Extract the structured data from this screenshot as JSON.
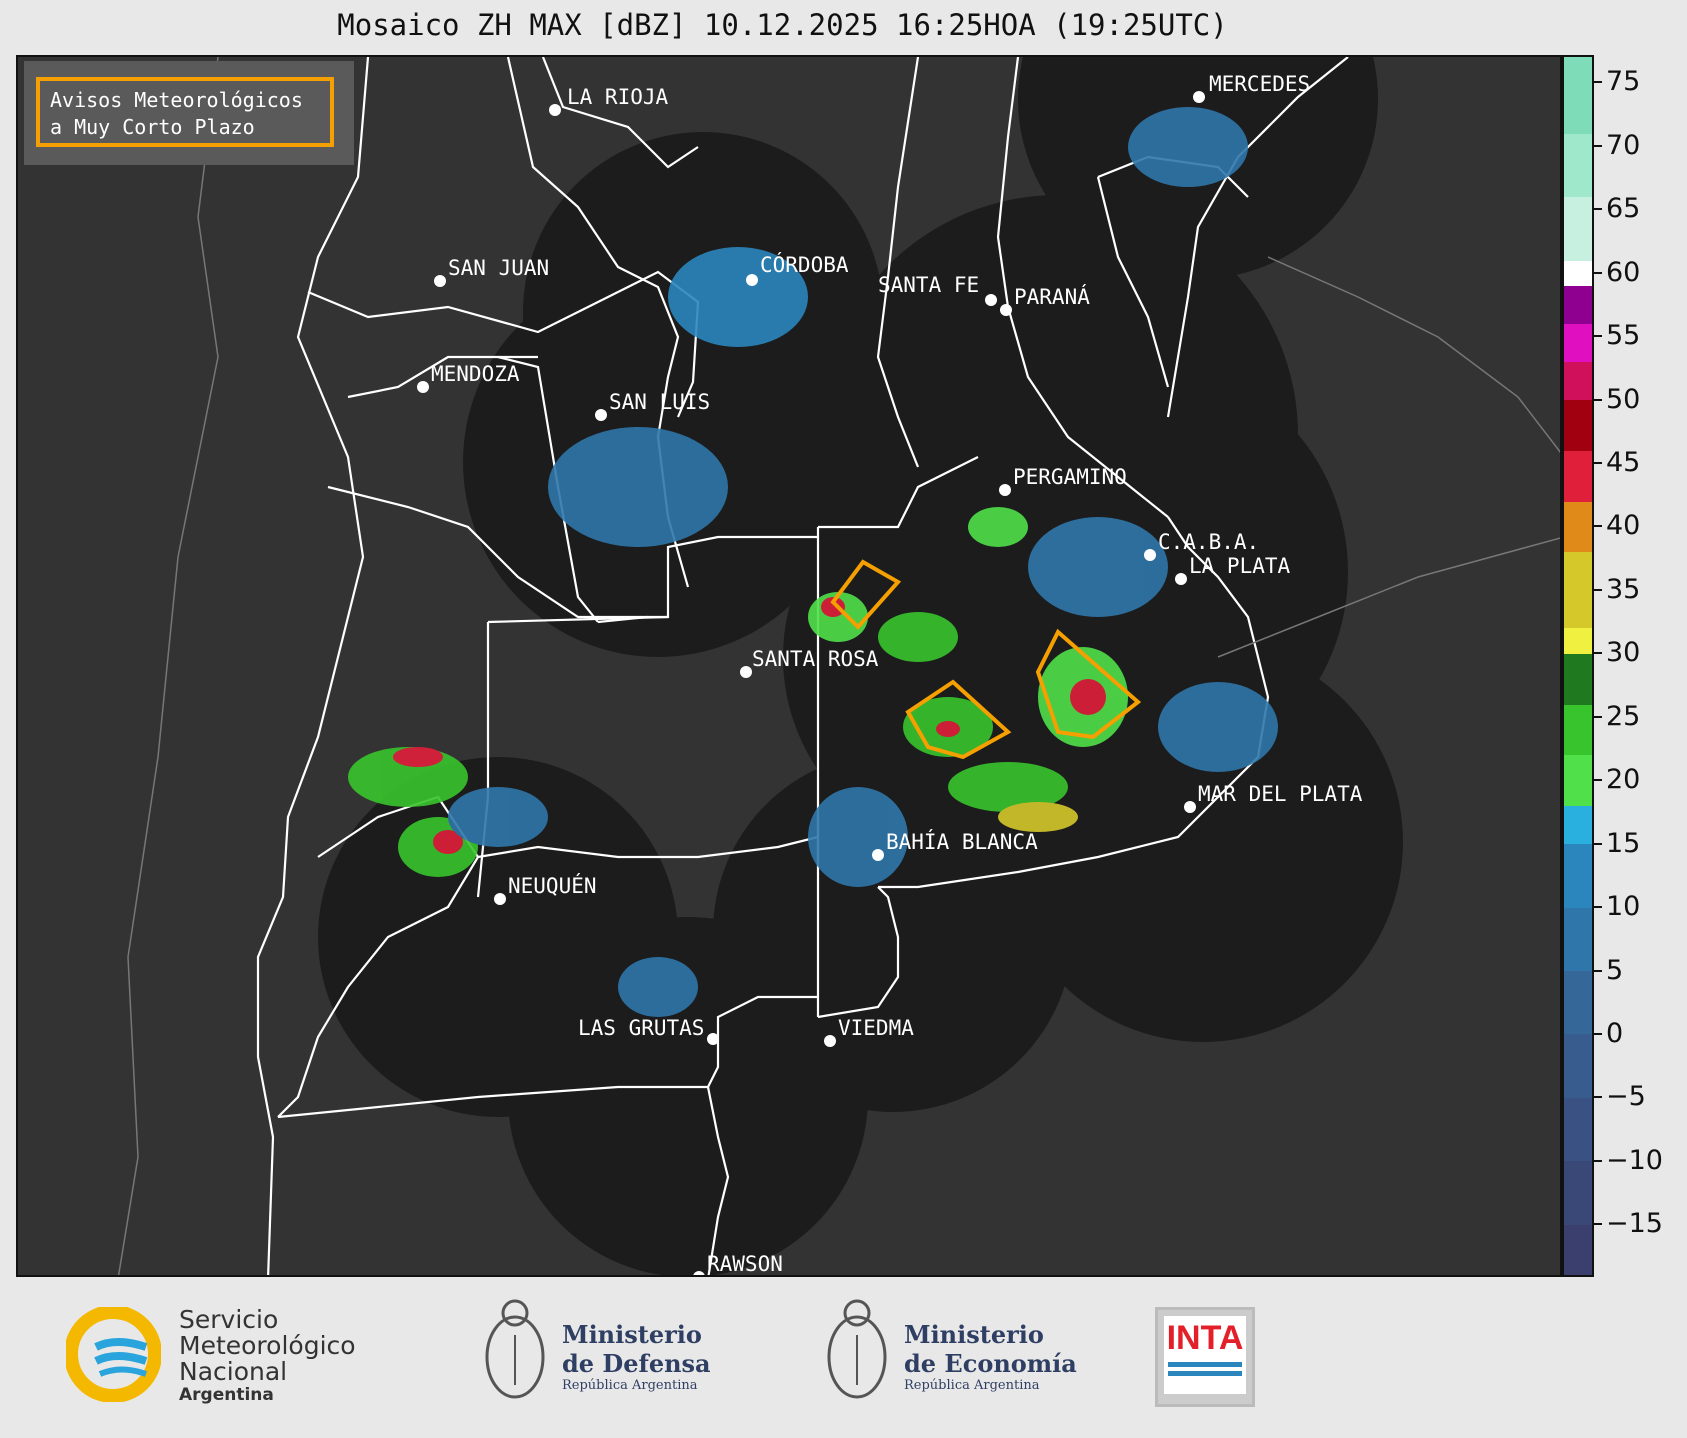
{
  "title": "Mosaico ZH MAX [dBZ] 10.12.2025 16:25HOA (19:25UTC)",
  "legend_box": {
    "line1": "Avisos Meteorológicos",
    "line2": "a Muy Corto Plazo"
  },
  "cities": [
    {
      "name": "LA RIOJA"
    },
    {
      "name": "SAN JUAN"
    },
    {
      "name": "MENDOZA"
    },
    {
      "name": "SAN LUIS"
    },
    {
      "name": "CÓRDOBA"
    },
    {
      "name": "SANTA FE"
    },
    {
      "name": "PARANÁ"
    },
    {
      "name": "MERCEDES"
    },
    {
      "name": "PERGAMINO"
    },
    {
      "name": "C.A.B.A."
    },
    {
      "name": "LA PLATA"
    },
    {
      "name": "SANTA ROSA"
    },
    {
      "name": "MAR DEL PLATA"
    },
    {
      "name": "BAHÍA BLANCA"
    },
    {
      "name": "NEUQUÉN"
    },
    {
      "name": "LAS GRUTAS"
    },
    {
      "name": "VIEDMA"
    },
    {
      "name": "RAWSON"
    }
  ],
  "colorbar": {
    "unit": "dBZ",
    "min": -19,
    "max": 77,
    "ticks": [
      "75",
      "70",
      "65",
      "60",
      "55",
      "50",
      "45",
      "40",
      "35",
      "30",
      "25",
      "20",
      "15",
      "10",
      "5",
      "0",
      "−5",
      "−10",
      "−15"
    ],
    "tick_values": [
      75,
      70,
      65,
      60,
      55,
      50,
      45,
      40,
      35,
      30,
      25,
      20,
      15,
      10,
      5,
      0,
      -5,
      -10,
      -15
    ],
    "bands": [
      {
        "from": -19,
        "to": -15,
        "color": "#3b3f6e"
      },
      {
        "from": -15,
        "to": -10,
        "color": "#3a4878"
      },
      {
        "from": -10,
        "to": -5,
        "color": "#395283"
      },
      {
        "from": -5,
        "to": 0,
        "color": "#385c8e"
      },
      {
        "from": 0,
        "to": 5,
        "color": "#356898"
      },
      {
        "from": 5,
        "to": 10,
        "color": "#2f77ab"
      },
      {
        "from": 10,
        "to": 15,
        "color": "#2a86bd"
      },
      {
        "from": 15,
        "to": 18,
        "color": "#2ab0de"
      },
      {
        "from": 18,
        "to": 22,
        "color": "#4fe04a"
      },
      {
        "from": 22,
        "to": 26,
        "color": "#38c42c"
      },
      {
        "from": 26,
        "to": 30,
        "color": "#1f7a1f"
      },
      {
        "from": 30,
        "to": 32,
        "color": "#f0f040"
      },
      {
        "from": 32,
        "to": 38,
        "color": "#d4c82a"
      },
      {
        "from": 38,
        "to": 42,
        "color": "#e08a1a"
      },
      {
        "from": 42,
        "to": 46,
        "color": "#e0203a"
      },
      {
        "from": 46,
        "to": 50,
        "color": "#a00010"
      },
      {
        "from": 50,
        "to": 53,
        "color": "#d0105a"
      },
      {
        "from": 53,
        "to": 56,
        "color": "#e010c0"
      },
      {
        "from": 56,
        "to": 59,
        "color": "#900090"
      },
      {
        "from": 59,
        "to": 61,
        "color": "#ffffff"
      },
      {
        "from": 61,
        "to": 66,
        "color": "#c8f0e0"
      },
      {
        "from": 66,
        "to": 71,
        "color": "#a0e8cc"
      },
      {
        "from": 71,
        "to": 77,
        "color": "#7fdcb8"
      }
    ]
  },
  "logos": {
    "smn_line1": "Servicio",
    "smn_line2": "Meteorológico",
    "smn_line3": "Nacional",
    "smn_line4": "Argentina",
    "defensa_line1": "Ministerio",
    "defensa_line2": "de Defensa",
    "defensa_line3": "República Argentina",
    "economia_line1": "Ministerio",
    "economia_line2": "de Economía",
    "economia_line3": "República Argentina",
    "inta": "INTA"
  },
  "colors": {
    "background": "#e8e8e8",
    "map_bg": "#333333",
    "radar_coverage": "#1c1c1c",
    "warning_polygon": "#f5a000",
    "border_line": "#ffffff"
  }
}
